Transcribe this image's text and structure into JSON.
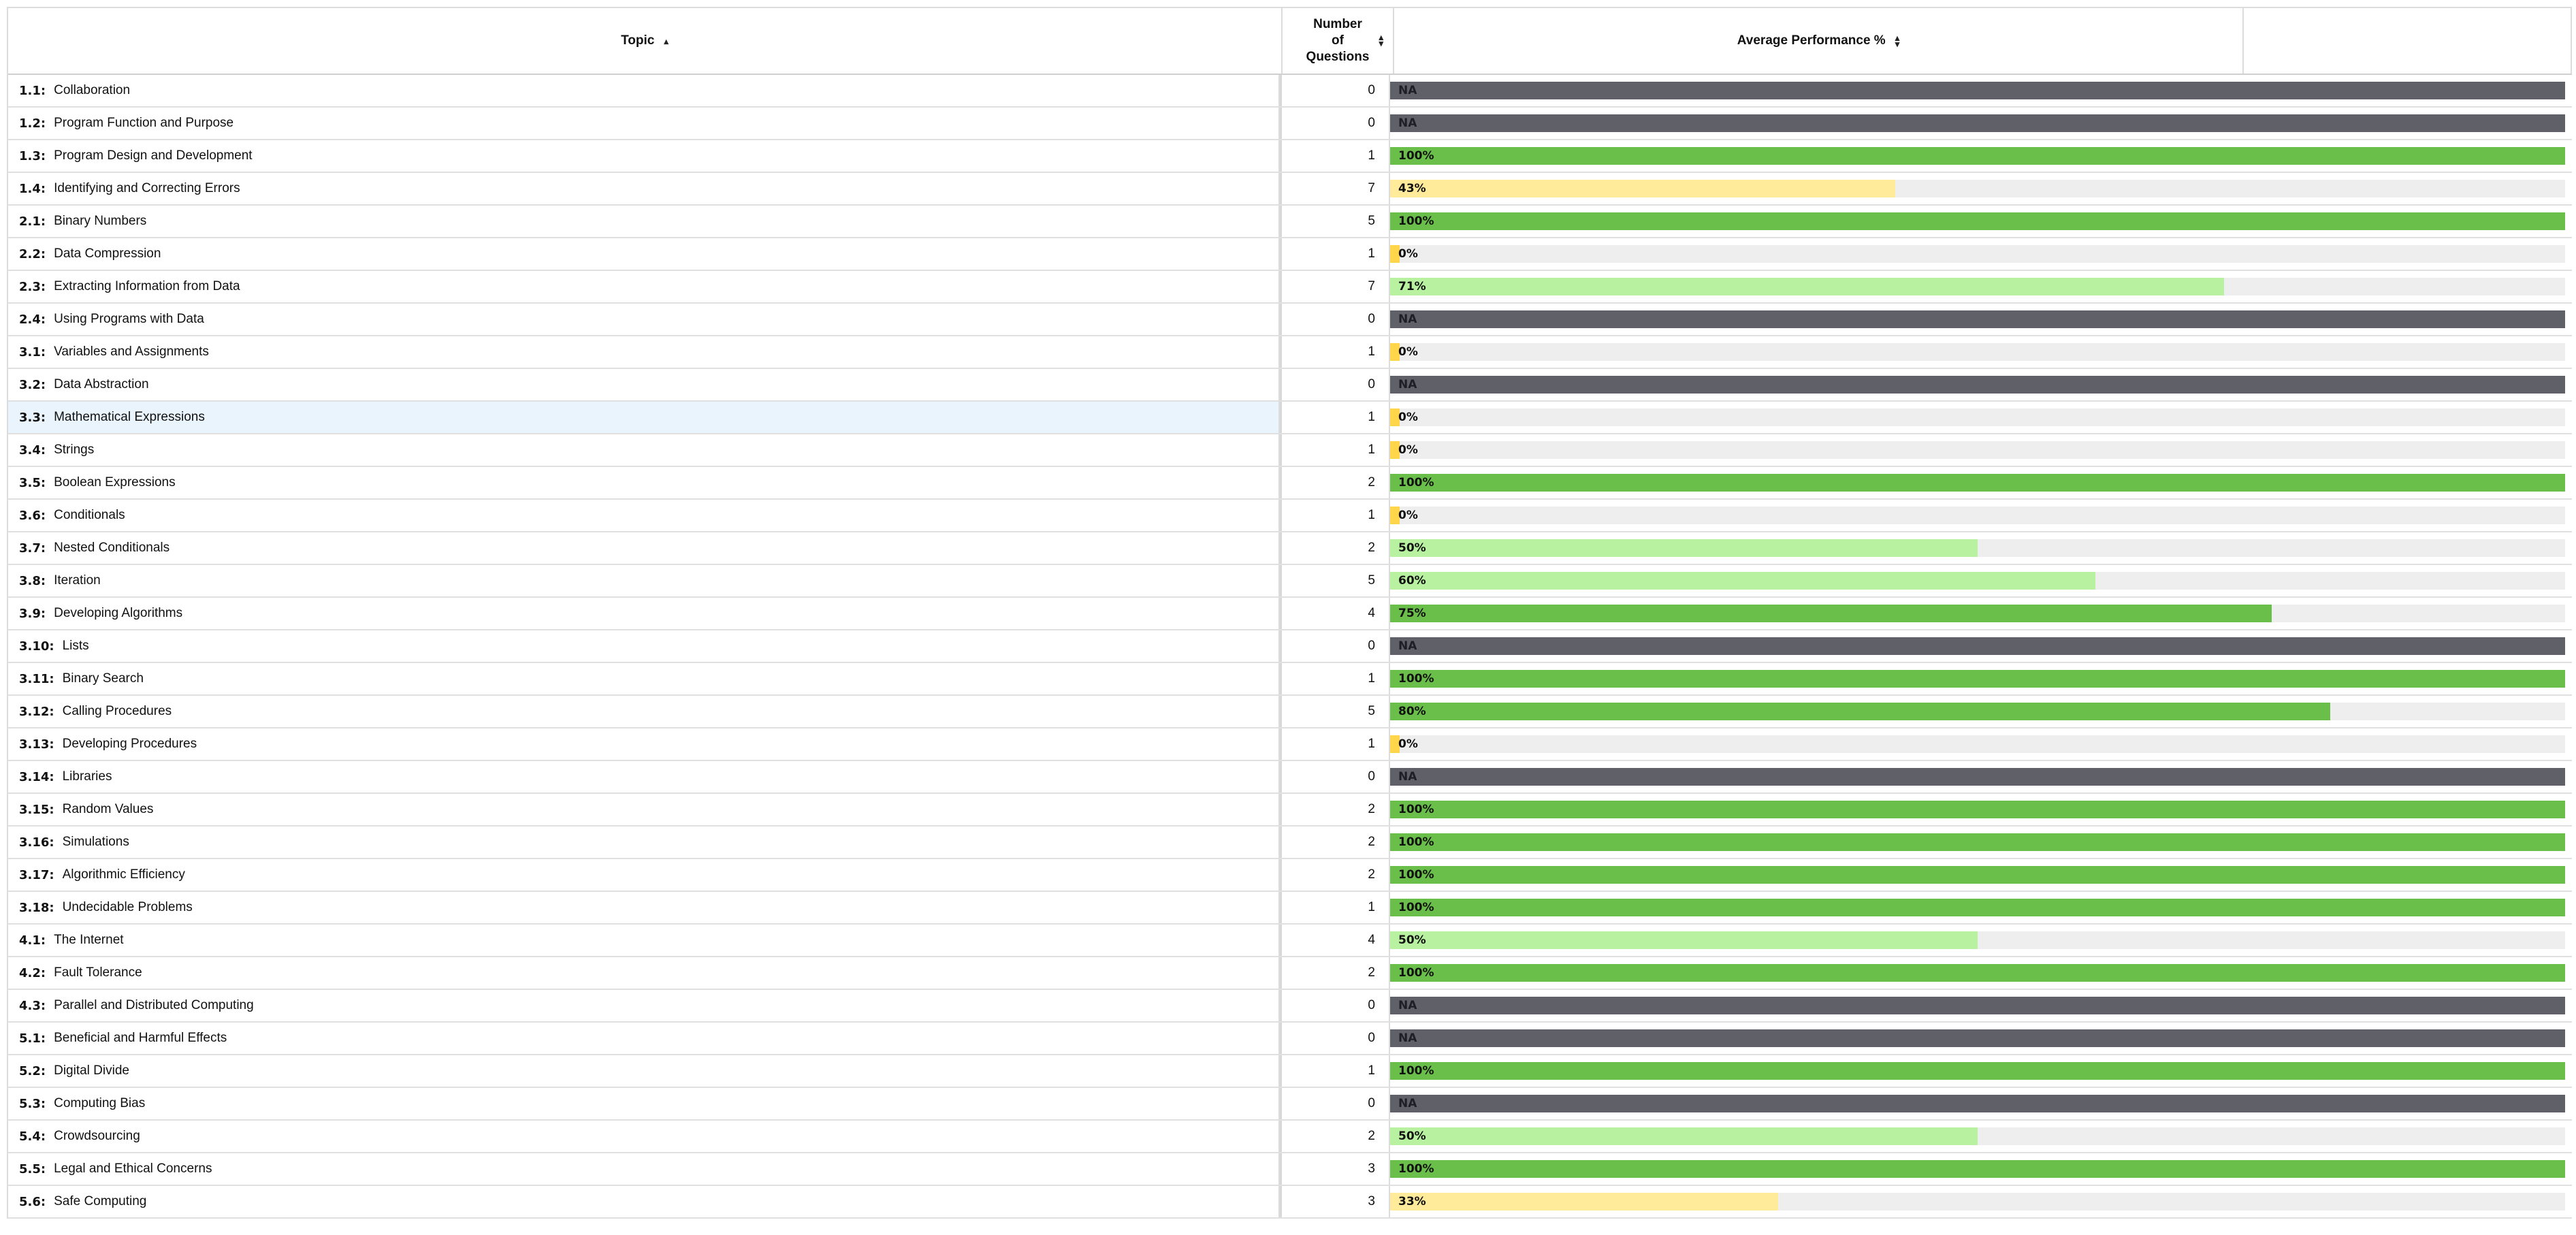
{
  "header": {
    "topic": "Topic",
    "questions": [
      "Number",
      "of",
      "Questions"
    ],
    "performance": "Average Performance %"
  },
  "colors": {
    "full": "#6abf4b",
    "high": "#b8f2a0",
    "low": "#ffeb99",
    "zero": "#ffd54a",
    "na": "#5f6068",
    "track": "#eeeeee"
  },
  "rows": [
    {
      "code": "1.1:",
      "topic": "Collaboration",
      "questions": "0",
      "perf": "NA",
      "value": null
    },
    {
      "code": "1.2:",
      "topic": "Program Function and Purpose",
      "questions": "0",
      "perf": "NA",
      "value": null
    },
    {
      "code": "1.3:",
      "topic": "Program Design and Development",
      "questions": "1",
      "perf": "100%",
      "value": 100
    },
    {
      "code": "1.4:",
      "topic": "Identifying and Correcting Errors",
      "questions": "7",
      "perf": "43%",
      "value": 43
    },
    {
      "code": "2.1:",
      "topic": "Binary Numbers",
      "questions": "5",
      "perf": "100%",
      "value": 100
    },
    {
      "code": "2.2:",
      "topic": "Data Compression",
      "questions": "1",
      "perf": "0%",
      "value": 0
    },
    {
      "code": "2.3:",
      "topic": "Extracting Information from Data",
      "questions": "7",
      "perf": "71%",
      "value": 71
    },
    {
      "code": "2.4:",
      "topic": "Using Programs with Data",
      "questions": "0",
      "perf": "NA",
      "value": null
    },
    {
      "code": "3.1:",
      "topic": "Variables and Assignments",
      "questions": "1",
      "perf": "0%",
      "value": 0
    },
    {
      "code": "3.2:",
      "topic": "Data Abstraction",
      "questions": "0",
      "perf": "NA",
      "value": null
    },
    {
      "code": "3.3:",
      "topic": "Mathematical Expressions",
      "questions": "1",
      "perf": "0%",
      "value": 0,
      "highlight": true
    },
    {
      "code": "3.4:",
      "topic": "Strings",
      "questions": "1",
      "perf": "0%",
      "value": 0
    },
    {
      "code": "3.5:",
      "topic": "Boolean Expressions",
      "questions": "2",
      "perf": "100%",
      "value": 100
    },
    {
      "code": "3.6:",
      "topic": "Conditionals",
      "questions": "1",
      "perf": "0%",
      "value": 0
    },
    {
      "code": "3.7:",
      "topic": "Nested Conditionals",
      "questions": "2",
      "perf": "50%",
      "value": 50
    },
    {
      "code": "3.8:",
      "topic": "Iteration",
      "questions": "5",
      "perf": "60%",
      "value": 60
    },
    {
      "code": "3.9:",
      "topic": "Developing Algorithms",
      "questions": "4",
      "perf": "75%",
      "value": 75
    },
    {
      "code": "3.10:",
      "topic": "Lists",
      "questions": "0",
      "perf": "NA",
      "value": null
    },
    {
      "code": "3.11:",
      "topic": "Binary Search",
      "questions": "1",
      "perf": "100%",
      "value": 100
    },
    {
      "code": "3.12:",
      "topic": "Calling Procedures",
      "questions": "5",
      "perf": "80%",
      "value": 80
    },
    {
      "code": "3.13:",
      "topic": "Developing Procedures",
      "questions": "1",
      "perf": "0%",
      "value": 0
    },
    {
      "code": "3.14:",
      "topic": "Libraries",
      "questions": "0",
      "perf": "NA",
      "value": null
    },
    {
      "code": "3.15:",
      "topic": "Random Values",
      "questions": "2",
      "perf": "100%",
      "value": 100
    },
    {
      "code": "3.16:",
      "topic": "Simulations",
      "questions": "2",
      "perf": "100%",
      "value": 100
    },
    {
      "code": "3.17:",
      "topic": "Algorithmic Efficiency",
      "questions": "2",
      "perf": "100%",
      "value": 100
    },
    {
      "code": "3.18:",
      "topic": "Undecidable Problems",
      "questions": "1",
      "perf": "100%",
      "value": 100
    },
    {
      "code": "4.1:",
      "topic": "The Internet",
      "questions": "4",
      "perf": "50%",
      "value": 50
    },
    {
      "code": "4.2:",
      "topic": "Fault Tolerance",
      "questions": "2",
      "perf": "100%",
      "value": 100
    },
    {
      "code": "4.3:",
      "topic": "Parallel and Distributed Computing",
      "questions": "0",
      "perf": "NA",
      "value": null
    },
    {
      "code": "5.1:",
      "topic": "Beneficial and Harmful Effects",
      "questions": "0",
      "perf": "NA",
      "value": null
    },
    {
      "code": "5.2:",
      "topic": "Digital Divide",
      "questions": "1",
      "perf": "100%",
      "value": 100
    },
    {
      "code": "5.3:",
      "topic": "Computing Bias",
      "questions": "0",
      "perf": "NA",
      "value": null
    },
    {
      "code": "5.4:",
      "topic": "Crowdsourcing",
      "questions": "2",
      "perf": "50%",
      "value": 50
    },
    {
      "code": "5.5:",
      "topic": "Legal and Ethical Concerns",
      "questions": "3",
      "perf": "100%",
      "value": 100
    },
    {
      "code": "5.6:",
      "topic": "Safe Computing",
      "questions": "3",
      "perf": "33%",
      "value": 33
    }
  ]
}
